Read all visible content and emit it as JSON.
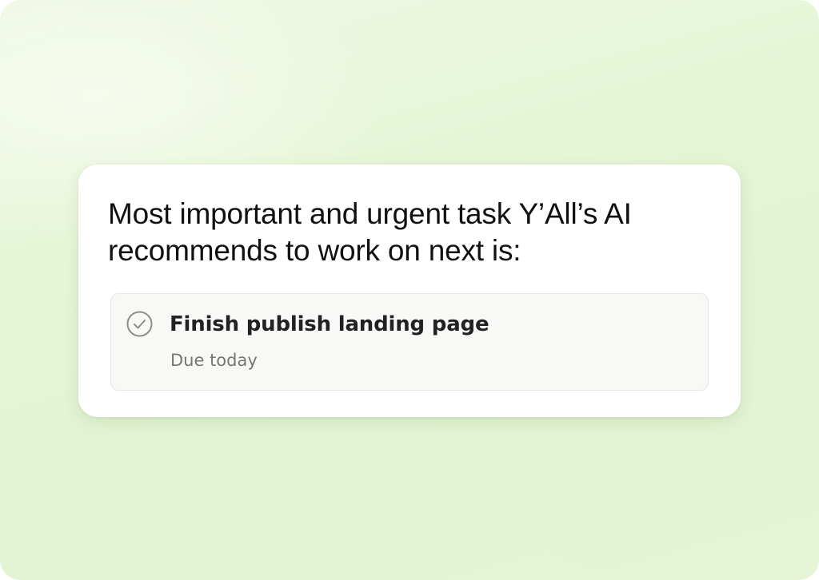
{
  "recommendation": {
    "headline": "Most important and urgent task Y’All’s AI recommends to work on next is:",
    "task": {
      "title": "Finish publish landing page",
      "due": "Due today",
      "icon": "check-circle-icon"
    }
  },
  "colors": {
    "background": "#e4f4d5",
    "card": "#ffffff",
    "task_background": "#f8f8f6",
    "text_primary": "#111111",
    "text_secondary": "#77776f"
  }
}
